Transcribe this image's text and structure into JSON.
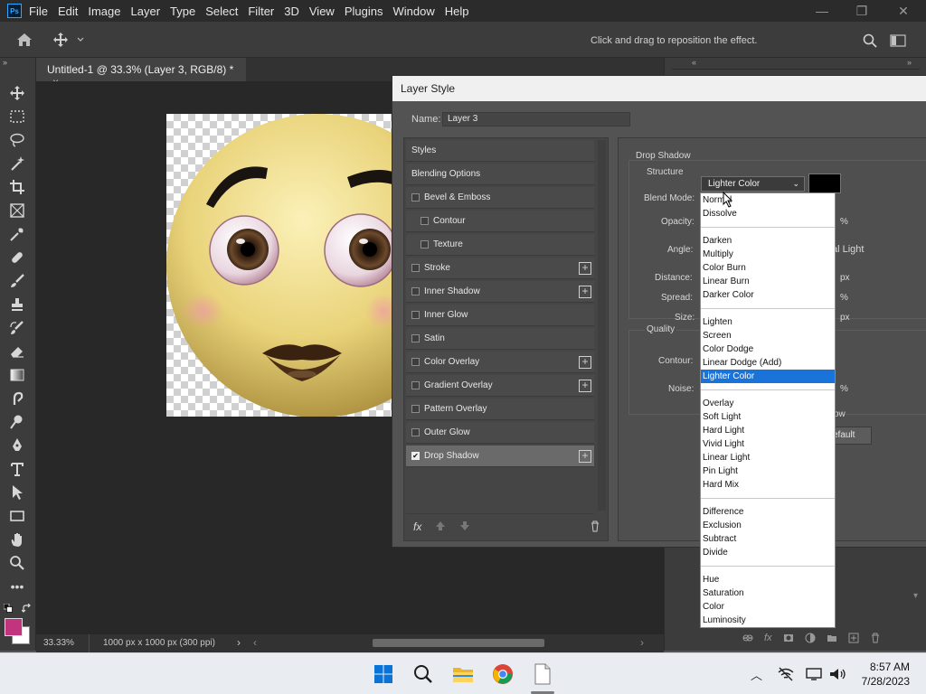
{
  "app": {
    "logo": "Ps",
    "menu": [
      "File",
      "Edit",
      "Image",
      "Layer",
      "Type",
      "Select",
      "Filter",
      "3D",
      "View",
      "Plugins",
      "Window",
      "Help"
    ],
    "window_controls": {
      "minimize": "—",
      "restore": "❐",
      "close": "✕"
    }
  },
  "options_bar": {
    "hint": "Click and drag to reposition the effect."
  },
  "document": {
    "tab_title": "Untitled-1 @ 33.3% (Layer 3, RGB/8) *",
    "tab_close": "×",
    "zoom": "33.33%",
    "info": "1000 px x 1000 px (300 ppi)"
  },
  "dialog": {
    "title": "Layer Style",
    "name_label": "Name:",
    "name_value": "Layer 3",
    "styles": [
      {
        "label": "Styles",
        "checkbox": false,
        "checked": false,
        "plus": false,
        "indent": 0
      },
      {
        "label": "Blending Options",
        "checkbox": false,
        "checked": false,
        "plus": false,
        "indent": 0
      },
      {
        "label": "Bevel & Emboss",
        "checkbox": true,
        "checked": false,
        "plus": false,
        "indent": 0
      },
      {
        "label": "Contour",
        "checkbox": true,
        "checked": false,
        "plus": false,
        "indent": 1
      },
      {
        "label": "Texture",
        "checkbox": true,
        "checked": false,
        "plus": false,
        "indent": 1
      },
      {
        "label": "Stroke",
        "checkbox": true,
        "checked": false,
        "plus": true,
        "indent": 0
      },
      {
        "label": "Inner Shadow",
        "checkbox": true,
        "checked": false,
        "plus": true,
        "indent": 0
      },
      {
        "label": "Inner Glow",
        "checkbox": true,
        "checked": false,
        "plus": false,
        "indent": 0
      },
      {
        "label": "Satin",
        "checkbox": true,
        "checked": false,
        "plus": false,
        "indent": 0
      },
      {
        "label": "Color Overlay",
        "checkbox": true,
        "checked": false,
        "plus": true,
        "indent": 0
      },
      {
        "label": "Gradient Overlay",
        "checkbox": true,
        "checked": false,
        "plus": true,
        "indent": 0
      },
      {
        "label": "Pattern Overlay",
        "checkbox": true,
        "checked": false,
        "plus": false,
        "indent": 0
      },
      {
        "label": "Outer Glow",
        "checkbox": true,
        "checked": false,
        "plus": false,
        "indent": 0
      },
      {
        "label": "Drop Shadow",
        "checkbox": true,
        "checked": true,
        "plus": true,
        "indent": 0,
        "selected": true
      }
    ],
    "fx_label": "fx",
    "section_title": "Drop Shadow",
    "structure_label": "Structure",
    "blend_mode_label": "Blend Mode:",
    "blend_mode_value": "Lighter Color",
    "blend_color": "#000000",
    "opacity_label": "Opacity:",
    "opacity_unit": "%",
    "angle_label": "Angle:",
    "angle_partial": "al Light",
    "distance_label": "Distance:",
    "distance_unit": "px",
    "spread_label": "Spread:",
    "spread_unit": "%",
    "size_label": "Size:",
    "size_unit": "px",
    "quality_label": "Quality",
    "contour_label": "Contour:",
    "noise_label": "Noise:",
    "noise_unit": "%",
    "partial_ow": "ow",
    "default_partial": "efault"
  },
  "blend_dropdown": {
    "selected": "Lighter Color",
    "groups": [
      [
        "Normal",
        "Dissolve"
      ],
      [
        "Darken",
        "Multiply",
        "Color Burn",
        "Linear Burn",
        "Darker Color"
      ],
      [
        "Lighten",
        "Screen",
        "Color Dodge",
        "Linear Dodge (Add)",
        "Lighter Color"
      ],
      [
        "Overlay",
        "Soft Light",
        "Hard Light",
        "Vivid Light",
        "Linear Light",
        "Pin Light",
        "Hard Mix"
      ],
      [
        "Difference",
        "Exclusion",
        "Subtract",
        "Divide"
      ],
      [
        "Hue",
        "Saturation",
        "Color",
        "Luminosity"
      ]
    ]
  },
  "colors": {
    "foreground": "#c2347e",
    "background": "#ffffff",
    "accent": "#1a73d9"
  },
  "taskbar": {
    "time": "8:57 AM",
    "date": "7/28/2023"
  }
}
